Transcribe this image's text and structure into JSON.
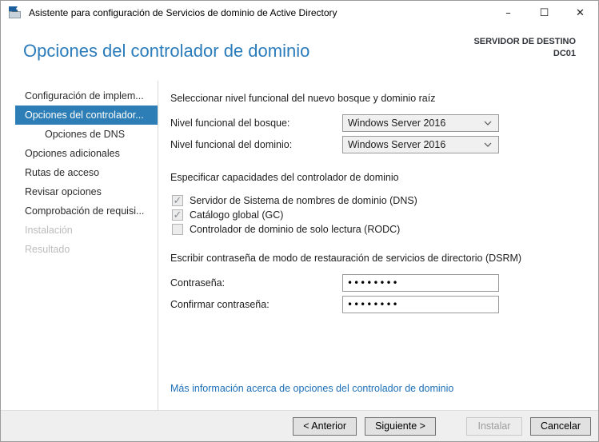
{
  "window": {
    "title": "Asistente para configuración de Servicios de dominio de Active Directory",
    "controls": {
      "minimize": "–",
      "maximize": "☐",
      "close": "✕"
    }
  },
  "header": {
    "title": "Opciones del controlador de dominio",
    "target_label": "SERVIDOR DE DESTINO",
    "target_value": "DC01"
  },
  "sidebar": {
    "items": [
      {
        "label": "Configuración de implem...",
        "state": "normal"
      },
      {
        "label": "Opciones del controlador...",
        "state": "selected"
      },
      {
        "label": "Opciones de DNS",
        "state": "child"
      },
      {
        "label": "Opciones adicionales",
        "state": "normal"
      },
      {
        "label": "Rutas de acceso",
        "state": "normal"
      },
      {
        "label": "Revisar opciones",
        "state": "normal"
      },
      {
        "label": "Comprobación de requisi...",
        "state": "normal"
      },
      {
        "label": "Instalación",
        "state": "disabled"
      },
      {
        "label": "Resultado",
        "state": "disabled"
      }
    ]
  },
  "content": {
    "functional_section": {
      "heading": "Seleccionar nivel funcional del nuevo bosque y dominio raíz",
      "forest_label": "Nivel funcional del bosque:",
      "forest_value": "Windows Server 2016",
      "domain_label": "Nivel funcional del dominio:",
      "domain_value": "Windows Server 2016"
    },
    "capabilities_section": {
      "heading": "Especificar capacidades del controlador de dominio",
      "checkboxes": [
        {
          "label": "Servidor de Sistema de nombres de dominio (DNS)",
          "checked": true
        },
        {
          "label": "Catálogo global (GC)",
          "checked": true
        },
        {
          "label": "Controlador de dominio de solo lectura (RODC)",
          "checked": false
        }
      ],
      "checkmark_glyph": "✓"
    },
    "password_section": {
      "heading": "Escribir contraseña de modo de restauración de servicios de directorio (DSRM)",
      "password_label": "Contraseña:",
      "password_value": "••••••••",
      "confirm_label": "Confirmar contraseña:",
      "confirm_value": "••••••••"
    },
    "more_info_link": "Más información acerca de opciones del controlador de dominio"
  },
  "footer": {
    "back_label": "< Anterior",
    "next_label": "Siguiente >",
    "install_label": "Instalar",
    "cancel_label": "Cancelar"
  },
  "colors": {
    "accent_blue": "#2b7cbb",
    "selected_nav": "#2d7db6",
    "link": "#1d6fb8",
    "footer_bg": "#efefef"
  }
}
